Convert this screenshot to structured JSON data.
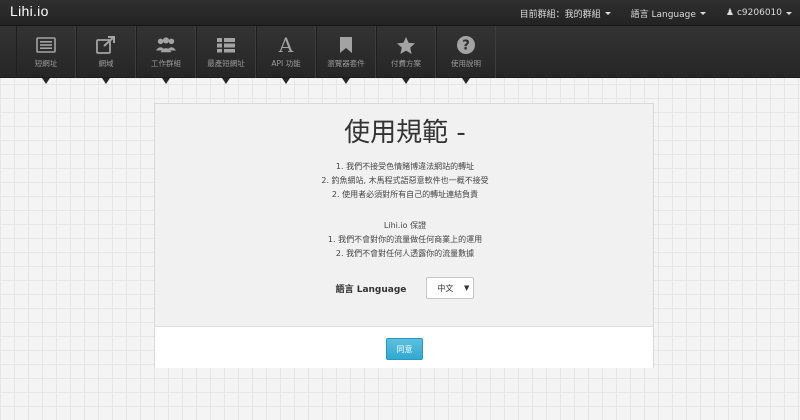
{
  "brand": "Lihi.io",
  "topnav": {
    "group": "目前群組：我的群組",
    "language": "語言 Language",
    "user": "c9206010"
  },
  "toolbar": [
    {
      "label": "短網址",
      "icon": "list-icon"
    },
    {
      "label": "網域",
      "icon": "external-link-icon"
    },
    {
      "label": "工作群組",
      "icon": "users-icon"
    },
    {
      "label": "最產短網址",
      "icon": "grid-list-icon"
    },
    {
      "label": "API 功能",
      "icon": "font-a-icon"
    },
    {
      "label": "瀏覽器套件",
      "icon": "bookmark-icon"
    },
    {
      "label": "付費方案",
      "icon": "star-icon"
    },
    {
      "label": "使用說明",
      "icon": "question-icon"
    }
  ],
  "card": {
    "title": "使用規範 -",
    "rules": [
      "1. 我們不接受色情賭博違法網站的轉址",
      "2. 釣魚網站, 木馬程式語惡意軟件也一概不接受",
      "2. 使用者必須對所有自己的轉址連結負責"
    ],
    "privacy_title": "Lihi.io 保證",
    "privacy": [
      "1. 我們不會對你的流量做任何商業上的運用",
      "2. 我們不會對任何人透露你的流量數據"
    ],
    "language_label": "語言 Language",
    "language_value": "中文",
    "agree_label": "同意"
  },
  "colors": {
    "topbar": "#2a2a2a",
    "accent_button": "#3fb3da"
  }
}
